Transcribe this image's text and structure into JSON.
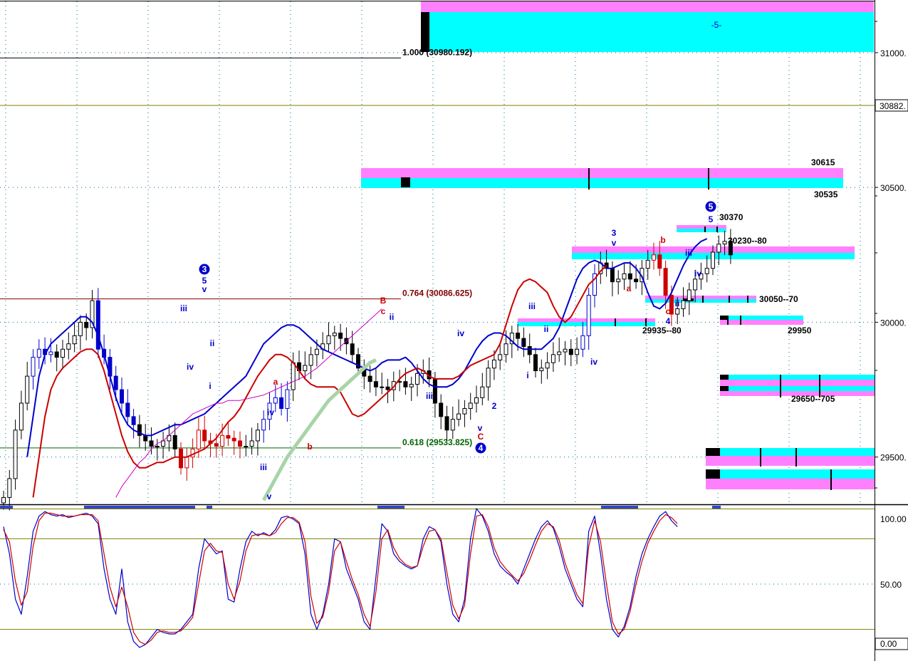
{
  "chart_data": [
    {
      "type": "line",
      "panel": "price",
      "ylim": [
        29330,
        31190
      ],
      "y_ticks": [
        {
          "value": 31000,
          "label": "31000."
        },
        {
          "value": 30500,
          "label": "30500."
        },
        {
          "value": 30000,
          "label": "30000."
        },
        {
          "value": 29500,
          "label": "29500."
        }
      ],
      "last_price_label": {
        "value": 30882,
        "label": "30882."
      },
      "fib_levels": [
        {
          "value": 30980.192,
          "label": "1.000  (30980.192)",
          "color": "#000000"
        },
        {
          "value": 30086.625,
          "label": "0.764  (30086.625)",
          "color": "#800000"
        },
        {
          "value": 29533.825,
          "label": "0.618  (29533.825)",
          "color": "#006600"
        }
      ],
      "zone_labels": [
        {
          "text": "-5-",
          "color": "#0000cc"
        },
        {
          "text": "30615",
          "color": "#000000"
        },
        {
          "text": "30535",
          "color": "#000000"
        },
        {
          "text": "30370",
          "color": "#000000"
        },
        {
          "text": "30230--80",
          "color": "#000000"
        },
        {
          "text": "30050--70",
          "color": "#000000"
        },
        {
          "text": "29935--80",
          "color": "#000000"
        },
        {
          "text": "29950",
          "color": "#000000"
        },
        {
          "text": "29650--705",
          "color": "#000000"
        }
      ],
      "wave_labels": [
        {
          "text": "3",
          "color": "#0000cc",
          "circled": true
        },
        {
          "text": "5",
          "color": "#0000cc"
        },
        {
          "text": "v",
          "color": "#0000cc"
        },
        {
          "text": "iii",
          "color": "#0000cc"
        },
        {
          "text": "iv",
          "color": "#0000cc"
        },
        {
          "text": "i",
          "color": "#0000cc"
        },
        {
          "text": "ii",
          "color": "#0000cc"
        },
        {
          "text": "a",
          "color": "#cc0000"
        },
        {
          "text": "b",
          "color": "#cc0000"
        },
        {
          "text": "iii",
          "color": "#0000cc"
        },
        {
          "text": "v",
          "color": "#0000cc"
        },
        {
          "text": "iv",
          "color": "#0000cc"
        },
        {
          "text": "B",
          "color": "#cc0000"
        },
        {
          "text": "c",
          "color": "#cc0000"
        },
        {
          "text": "ii",
          "color": "#0000cc"
        },
        {
          "text": "iii",
          "color": "#0000cc"
        },
        {
          "text": "iv",
          "color": "#0000cc"
        },
        {
          "text": "i",
          "color": "#0000cc"
        },
        {
          "text": "v",
          "color": "#0000cc"
        },
        {
          "text": "C",
          "color": "#cc0000"
        },
        {
          "text": "4",
          "color": "#0000cc",
          "circled": true
        },
        {
          "text": "2",
          "color": "#0000cc"
        },
        {
          "text": "i",
          "color": "#0000cc"
        },
        {
          "text": "iii",
          "color": "#0000cc"
        },
        {
          "text": "ii",
          "color": "#0000cc"
        },
        {
          "text": "iv",
          "color": "#0000cc"
        },
        {
          "text": "3",
          "color": "#0000cc"
        },
        {
          "text": "v",
          "color": "#0000cc"
        },
        {
          "text": "a",
          "color": "#cc0000"
        },
        {
          "text": "b",
          "color": "#cc0000"
        },
        {
          "text": "c",
          "color": "#cc0000"
        },
        {
          "text": "4",
          "color": "#0000cc"
        },
        {
          "text": "ii",
          "color": "#0000cc"
        },
        {
          "text": "iii",
          "color": "#0000cc"
        },
        {
          "text": "iv",
          "color": "#0000cc"
        },
        {
          "text": "5",
          "color": "#0000cc"
        },
        {
          "text": "5",
          "color": "#0000cc",
          "circled": true
        }
      ],
      "series": [
        {
          "role": "price_close",
          "color": "#000000",
          "values": [
            29350,
            29420,
            29600,
            29700,
            29800,
            29870,
            29900,
            29880,
            29890,
            29870,
            29900,
            29920,
            29950,
            30000,
            29980,
            30080,
            29900,
            29870,
            29800,
            29750,
            29700,
            29650,
            29620,
            29580,
            29560,
            29540,
            29540,
            29560,
            29580,
            29530,
            29460,
            29500,
            29530,
            29600,
            29560,
            29550,
            29540,
            29580,
            29570,
            29560,
            29540,
            29540,
            29560,
            29600,
            29640,
            29700,
            29720,
            29680,
            29750,
            29850,
            29820,
            29840,
            29880,
            29900,
            29920,
            29950,
            29960,
            29940,
            29920,
            29880,
            29830,
            29800,
            29780,
            29760,
            29760,
            29750,
            29780,
            29780,
            29760,
            29770,
            29810,
            29820,
            29790,
            29700,
            29650,
            29600,
            29640,
            29660,
            29680,
            29700,
            29720,
            29760,
            29830,
            29860,
            29880,
            29920,
            29960,
            29940,
            29910,
            29880,
            29820,
            29830,
            29850,
            29880,
            29890,
            29900,
            29880,
            29900,
            29950,
            30100,
            30180,
            30220,
            30200,
            30150,
            30160,
            30180,
            30160,
            30150,
            30200,
            30230,
            30250,
            30200,
            30100,
            30030,
            30050,
            30080,
            30120,
            30160,
            30180,
            30200,
            30260,
            30290,
            30300,
            30250
          ]
        },
        {
          "role": "upper_band",
          "color": "#0000cc",
          "values": [
            null,
            null,
            null,
            null,
            29500,
            29650,
            29800,
            29880,
            29920,
            29940,
            29960,
            29980,
            30000,
            30020,
            30020,
            30000,
            29950,
            29880,
            29800,
            29720,
            29660,
            29620,
            29600,
            29590,
            29580,
            29580,
            29590,
            29600,
            29610,
            29620,
            29620,
            29630,
            29640,
            29650,
            29660,
            29680,
            29700,
            29720,
            29740,
            29760,
            29780,
            29800,
            29840,
            29880,
            29920,
            29940,
            29960,
            29980,
            29990,
            29990,
            29980,
            29960,
            29940,
            29920,
            29900,
            29890,
            29880,
            29870,
            29860,
            29850,
            29840,
            29830,
            29820,
            29830,
            29850,
            29860,
            29860,
            29860,
            29870,
            29850,
            29820,
            29790,
            29770,
            29760,
            29760,
            29760,
            29770,
            29790,
            29820,
            29860,
            29900,
            29930,
            29950,
            29960,
            29960,
            29950,
            29930,
            29910,
            29900,
            29900,
            29900,
            29900,
            29920,
            29940,
            29980,
            30040,
            30100,
            30160,
            30200,
            30220,
            30230,
            30220,
            30200,
            30200,
            30210,
            30220,
            30220,
            30200,
            30170,
            30110,
            30060,
            30050,
            30070,
            30110,
            30160,
            30210,
            30250,
            30280,
            30300,
            30310
          ]
        },
        {
          "role": "lower_band",
          "color": "#cc0000",
          "values": [
            null,
            null,
            null,
            null,
            null,
            29350,
            29500,
            29650,
            29750,
            29800,
            29830,
            29850,
            29870,
            29890,
            29900,
            29900,
            29880,
            29820,
            29740,
            29660,
            29580,
            29520,
            29480,
            29460,
            29460,
            29470,
            29480,
            29480,
            29490,
            29500,
            29500,
            29500,
            29510,
            29520,
            29530,
            29550,
            29570,
            29600,
            29630,
            29650,
            29680,
            29720,
            29760,
            29800,
            29830,
            29860,
            29880,
            29880,
            29870,
            29850,
            29820,
            29790,
            29770,
            29760,
            29760,
            29760,
            29760,
            29740,
            29700,
            29660,
            29650,
            29660,
            29680,
            29700,
            29720,
            29740,
            29760,
            29790,
            29810,
            29820,
            29830,
            29820,
            29800,
            29790,
            29790,
            29790,
            29790,
            29800,
            29820,
            29840,
            29850,
            29860,
            29870,
            29880,
            29920,
            29990,
            30060,
            30120,
            30150,
            30160,
            30150,
            30130,
            30110,
            30060,
            30020,
            30000,
            30020,
            30060,
            30100,
            30140,
            30160,
            30190,
            30210
          ]
        },
        {
          "role": "slow_average",
          "color": "#cc00cc",
          "values": [
            null,
            null,
            null,
            null,
            null,
            null,
            null,
            null,
            null,
            null,
            null,
            null,
            null,
            null,
            null,
            null,
            null,
            null,
            null,
            29350,
            29390,
            29420,
            29450,
            29480,
            29500,
            29530,
            29550,
            29560,
            29580,
            29600,
            29620,
            29640,
            29660,
            29670,
            29680,
            29690,
            29700,
            29700,
            29710,
            29710,
            29710,
            29715,
            29720,
            29725,
            29730,
            29740,
            29750,
            29760,
            29770,
            29780,
            29790,
            29800,
            29815,
            29830,
            29850,
            29870,
            29890,
            29910,
            29930,
            29950,
            29970,
            29990,
            30010,
            30030,
            30050
          ]
        },
        {
          "role": "long_average",
          "color": "#a8d4a8",
          "values": [
            null,
            null,
            null,
            null,
            null,
            null,
            null,
            null,
            null,
            null,
            null,
            null,
            null,
            null,
            null,
            null,
            null,
            null,
            null,
            null,
            null,
            null,
            null,
            null,
            null,
            null,
            null,
            null,
            null,
            null,
            null,
            null,
            null,
            null,
            null,
            null,
            null,
            null,
            null,
            null,
            null,
            null,
            null,
            null,
            29340,
            29380,
            29420,
            29460,
            29500,
            29530,
            29560,
            29590,
            29620,
            29650,
            29680,
            29710,
            29730,
            29750,
            29770,
            29790,
            29810,
            29830,
            29850,
            29860
          ]
        }
      ]
    },
    {
      "type": "line",
      "panel": "oscillator",
      "ylim": [
        0,
        100
      ],
      "y_ticks": [
        {
          "value": 100,
          "label": "100.00"
        },
        {
          "value": 50,
          "label": "50.00"
        },
        {
          "value": 0,
          "label": "0.00"
        }
      ],
      "series": [
        {
          "role": "fast",
          "color": "#0000cc",
          "values": [
            88,
            70,
            40,
            30,
            55,
            85,
            95,
            98,
            96,
            95,
            96,
            94,
            95,
            96,
            97,
            95,
            90,
            60,
            40,
            30,
            60,
            25,
            12,
            8,
            10,
            15,
            20,
            18,
            17,
            17,
            20,
            25,
            30,
            60,
            80,
            75,
            70,
            72,
            40,
            38,
            60,
            78,
            85,
            82,
            84,
            82,
            86,
            94,
            95,
            93,
            90,
            70,
            30,
            20,
            30,
            50,
            80,
            78,
            60,
            50,
            40,
            25,
            20,
            55,
            90,
            85,
            70,
            65,
            62,
            60,
            62,
            80,
            88,
            86,
            78,
            50,
            30,
            25,
            40,
            80,
            100,
            95,
            85,
            70,
            62,
            58,
            55,
            50,
            60,
            70,
            80,
            88,
            92,
            87,
            75,
            60,
            50,
            40,
            35,
            85,
            95,
            70,
            40,
            20,
            15,
            22,
            35,
            55,
            70,
            80,
            88,
            95,
            98,
            92,
            88
          ]
        },
        {
          "role": "slow",
          "color": "#cc0000",
          "values": [
            86,
            78,
            52,
            36,
            45,
            75,
            92,
            97,
            97,
            96,
            95,
            95,
            95,
            96,
            96,
            96,
            92,
            70,
            48,
            35,
            48,
            35,
            18,
            12,
            10,
            13,
            18,
            19,
            18,
            18,
            19,
            23,
            28,
            50,
            72,
            77,
            72,
            71,
            50,
            40,
            52,
            72,
            82,
            83,
            83,
            82,
            84,
            90,
            94,
            94,
            91,
            78,
            42,
            24,
            28,
            45,
            72,
            78,
            65,
            53,
            43,
            30,
            22,
            45,
            80,
            86,
            74,
            67,
            63,
            61,
            62,
            75,
            85,
            86,
            80,
            58,
            36,
            27,
            36,
            70,
            95,
            96,
            88,
            74,
            65,
            60,
            56,
            52,
            57,
            66,
            76,
            85,
            90,
            88,
            79,
            64,
            53,
            43,
            37,
            75,
            92,
            78,
            50,
            25,
            17,
            20,
            32,
            50,
            65,
            77,
            85,
            92,
            96,
            94,
            90
          ]
        }
      ]
    }
  ]
}
